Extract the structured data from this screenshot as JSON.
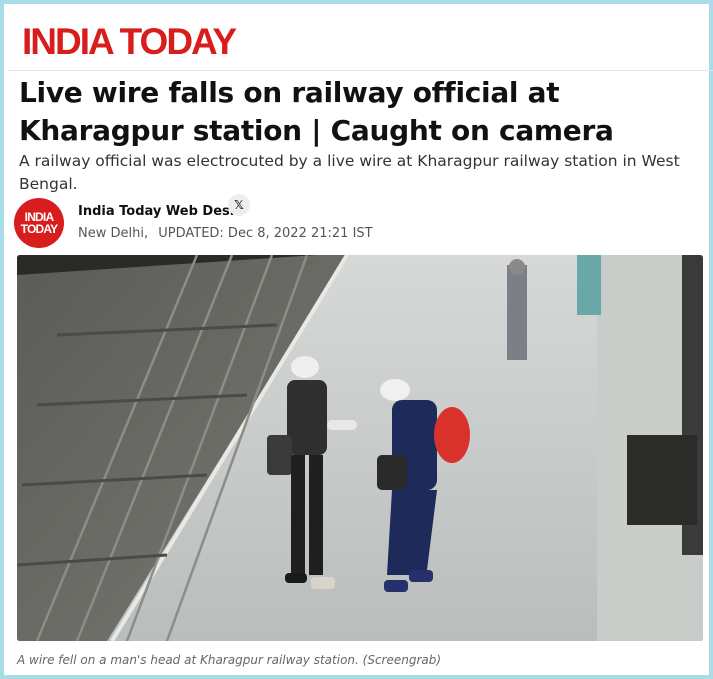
{
  "brand": {
    "name": "INDIA TODAY",
    "logo_text": [
      "INDIA",
      "TODAY"
    ],
    "color": "#d81d1d"
  },
  "article": {
    "headline": "Live wire falls on railway official at Kharagpur station | Caught on camera",
    "summary": "A railway official was electrocuted by a live wire at Kharagpur railway station in West Bengal.",
    "author": "India Today Web Desk",
    "social_icon": "x-icon",
    "location": "New Delhi,",
    "updated": "UPDATED: Dec 8, 2022 21:21 IST",
    "caption": "A wire fell on a man's head at Kharagpur railway station. (Screengrab)"
  }
}
